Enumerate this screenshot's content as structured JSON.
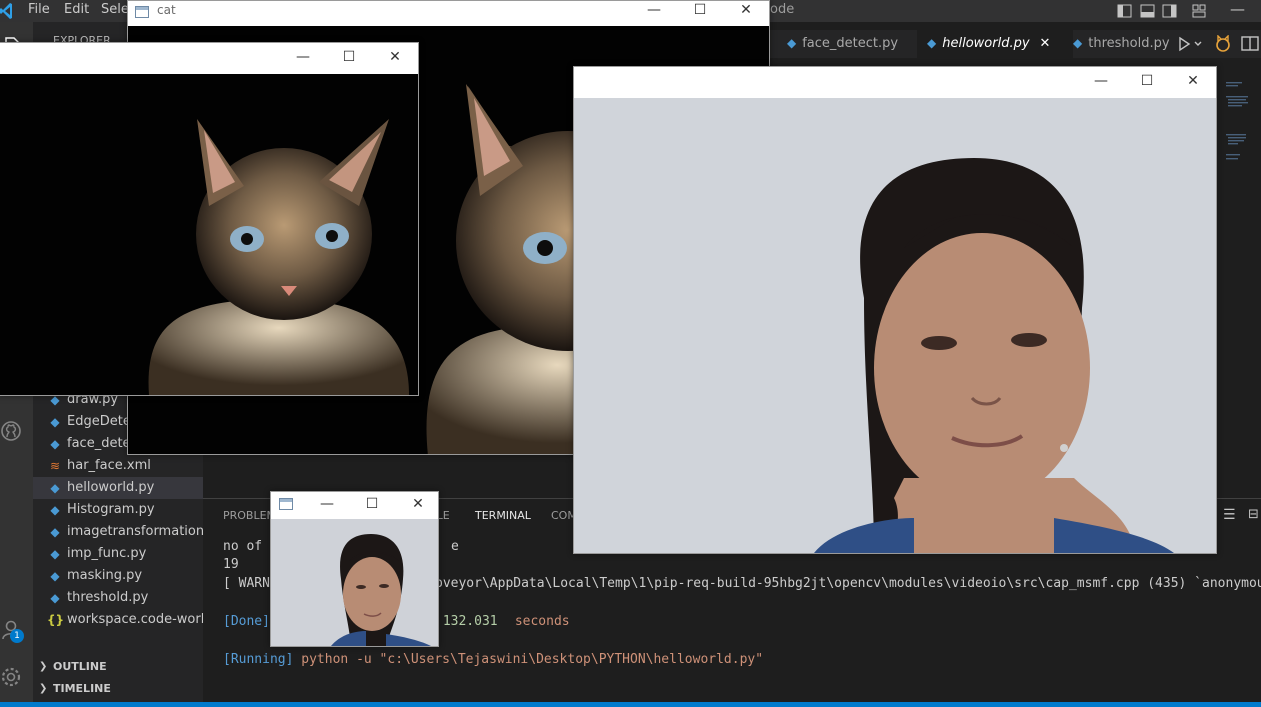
{
  "menu": {
    "file": "File",
    "edit": "Edit",
    "selection": "Sele",
    "title_suffix": "ode"
  },
  "sidebar": {
    "explorer_label": "EXPLORER",
    "files": [
      {
        "name": "draw.py",
        "type": "py"
      },
      {
        "name": "EdgeDetec",
        "type": "py"
      },
      {
        "name": "face_detec",
        "type": "py"
      },
      {
        "name": "har_face.xml",
        "type": "xml"
      },
      {
        "name": "helloworld.py",
        "type": "py",
        "active": true
      },
      {
        "name": "Histogram.py",
        "type": "py"
      },
      {
        "name": "imagetransformations...",
        "type": "py"
      },
      {
        "name": "imp_func.py",
        "type": "py"
      },
      {
        "name": "masking.py",
        "type": "py"
      },
      {
        "name": "threshold.py",
        "type": "py"
      },
      {
        "name": "workspace.code-work...",
        "type": "json"
      }
    ],
    "outline": "OUTLINE",
    "timeline": "TIMELINE"
  },
  "activity": {
    "accounts_badge": "1"
  },
  "tabs": [
    {
      "label": "face_detect.py"
    },
    {
      "label": "helloworld.py",
      "active": true,
      "close": "✕"
    },
    {
      "label": "threshold.py"
    }
  ],
  "panel": {
    "tabs": [
      "PROBLEM",
      "OLE",
      "TERMINAL",
      "COM"
    ],
    "lines": [
      {
        "a": "no of ",
        "b": "",
        "c": "e"
      },
      {
        "a": "19",
        "b": "",
        "c": ""
      },
      {
        "a": "[ WARN",
        "b": "",
        "c": "pveyor\\AppData\\Local\\Temp\\1\\pip-req-build-95hbg2jt\\opencv\\modules\\videoio\\src\\cap_msmf.cpp (435) `anonymous"
      },
      {
        "a": "[Done]",
        "b": " 132.031",
        "c": " seconds"
      },
      {
        "a": "[Running]",
        "b": " python -u ",
        "c": "\"c:\\Users\\Tejaswini\\Desktop\\PYTHON\\helloworld.py\""
      }
    ]
  },
  "windows": {
    "cat_title": "cat",
    "min": "—",
    "max": "☐",
    "close": "✕"
  },
  "icons": [
    "vscode-logo-icon",
    "files-icon",
    "github-icon",
    "accounts-icon",
    "settings-icon",
    "python-file-icon",
    "xml-file-icon",
    "json-file-icon",
    "run-icon",
    "layout-icon",
    "split-editor-icon"
  ],
  "colors": {
    "accent": "#007acc",
    "sidebar": "#252526",
    "editor": "#1e1e1e"
  }
}
